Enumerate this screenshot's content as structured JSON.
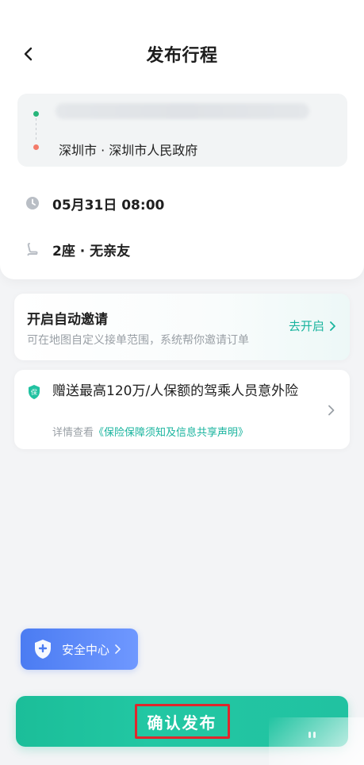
{
  "header": {
    "title": "发布行程"
  },
  "route": {
    "start_label": "",
    "end_label": "深圳市 · 深圳市人民政府"
  },
  "schedule": {
    "time": "05月31日 08:00",
    "seats": "2座 · 无亲友"
  },
  "invite": {
    "title": "开启自动邀请",
    "subtitle": "可在地图自定义接单范围，系统帮你邀请订单",
    "action_label": "去开启"
  },
  "insurance": {
    "title": "赠送最高120万/人保额的驾乘人员意外险",
    "desc_prefix": "详情查看",
    "link_text": "《保险保障须知及信息共享声明》",
    "badge": "保"
  },
  "safety": {
    "label": "安全中心"
  },
  "footer": {
    "confirm_label": "确认发布"
  },
  "colors": {
    "accent_green": "#1bbe99",
    "safety_blue": "#4b7cf2",
    "start_dot": "#27b57a",
    "end_dot": "#f37b6a",
    "highlight_red": "#e0262c"
  }
}
